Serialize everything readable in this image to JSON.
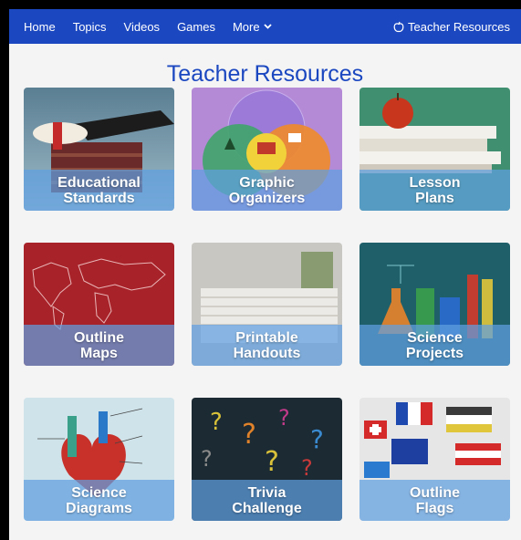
{
  "nav": {
    "items": [
      {
        "label": "Home"
      },
      {
        "label": "Topics"
      },
      {
        "label": "Videos"
      },
      {
        "label": "Games"
      },
      {
        "label": "More"
      }
    ],
    "teacher_link": "Teacher Resources"
  },
  "page": {
    "title": "Teacher Resources"
  },
  "cards": [
    {
      "label": "Educational\nStandards",
      "icon": "diploma-image"
    },
    {
      "label": "Graphic\nOrganizers",
      "icon": "venn-diagram-image"
    },
    {
      "label": "Lesson\nPlans",
      "icon": "apple-books-image"
    },
    {
      "label": "Outline\nMaps",
      "icon": "world-map-image"
    },
    {
      "label": "Printable\nHandouts",
      "icon": "paper-stack-image"
    },
    {
      "label": "Science\nProjects",
      "icon": "beakers-image"
    },
    {
      "label": "Science\nDiagrams",
      "icon": "heart-diagram-image"
    },
    {
      "label": "Trivia\nChallenge",
      "icon": "question-marks-image"
    },
    {
      "label": "Outline\nFlags",
      "icon": "flags-image"
    }
  ],
  "colors": {
    "nav_bg": "#1b47c0",
    "title": "#1b47c0",
    "page_bg": "#f4f4f4",
    "overlay": "#5fa0e1"
  }
}
